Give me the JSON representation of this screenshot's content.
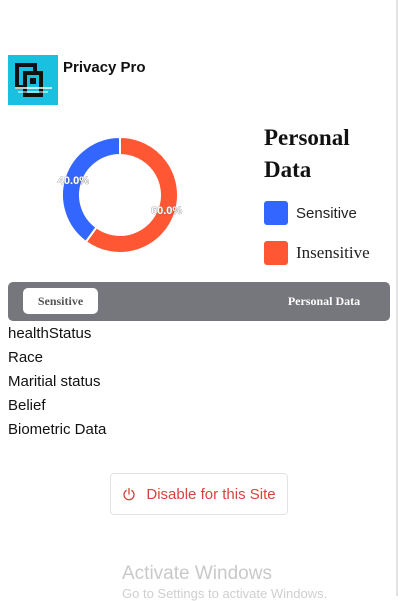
{
  "app": {
    "name": "Privacy Pro"
  },
  "chart_data": {
    "type": "pie",
    "donut": true,
    "title": "Personal Data",
    "slices": [
      {
        "label": "Sensitive",
        "value": 40.0,
        "display": "40.0%",
        "color": "#3366ff"
      },
      {
        "label": "Insensitive",
        "value": 60.0,
        "display": "60.0%",
        "color": "#ff5733"
      }
    ],
    "legend_placement": "right"
  },
  "tabs": [
    {
      "label": "Sensitive",
      "active": true
    },
    {
      "label": "Personal Data",
      "active": false
    }
  ],
  "sensitive_items": [
    "healthStatus",
    "Race",
    "Maritial status",
    "Belief",
    "Biometric Data"
  ],
  "disable_button": {
    "label": "Disable for this Site",
    "icon": "power-icon",
    "color": "#d9433e"
  },
  "watermark": {
    "title": "Activate Windows",
    "subtitle": "Go to Settings to activate Windows."
  }
}
